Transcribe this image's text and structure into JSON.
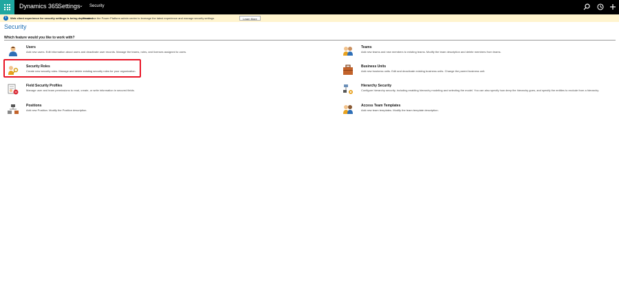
{
  "app": {
    "title": "Dynamics 365",
    "area": "Settings",
    "breadcrumb": "Security"
  },
  "notice": {
    "title": "Web client experience for security settings is being deprecated",
    "text": "Please use the Power Platform admin center to leverage the latest experience and manage security settings.",
    "button_label": "Learn More"
  },
  "page": {
    "title": "Security",
    "question": "Which feature would you like to work with?"
  },
  "items": [
    {
      "title": "Users",
      "description": "Add new users. Edit information about users and deactivate user records. Manage the teams, roles, and licenses assigned to users.",
      "icon": "users-icon"
    },
    {
      "title": "Teams",
      "description": "Add new teams and new members to existing teams. Modify the team description and delete members from teams.",
      "icon": "teams-icon"
    },
    {
      "title": "Security Roles",
      "description": "Create new security roles. Manage and delete existing security roles for your organization.",
      "icon": "security-roles-icon"
    },
    {
      "title": "Business Units",
      "description": "Add new business units. Edit and deactivate existing business units. Change the parent business unit.",
      "icon": "business-units-icon"
    },
    {
      "title": "Field Security Profiles",
      "description": "Manage user and team permissions to read, create, or write information in secured fields.",
      "icon": "field-security-icon"
    },
    {
      "title": "Hierarchy Security",
      "description": "Configure hierarchy security, including enabling hierarchy modeling and selecting the model. You can also specify how deep the hierarchy goes, and specify the entities to exclude from a hierarchy.",
      "icon": "hierarchy-icon"
    },
    {
      "title": "Positions",
      "description": "Add new Position. Modify the Position description.",
      "icon": "positions-icon"
    },
    {
      "title": "Access Team Templates",
      "description": "Add new team templates. Modify the team template description.",
      "icon": "access-team-icon"
    }
  ],
  "colors": {
    "topbar": "#000000",
    "waffle": "#1fa7a0",
    "notice_bg": "#fff4ce",
    "highlight": "#e81123",
    "title_blue": "#1f6fb4"
  }
}
